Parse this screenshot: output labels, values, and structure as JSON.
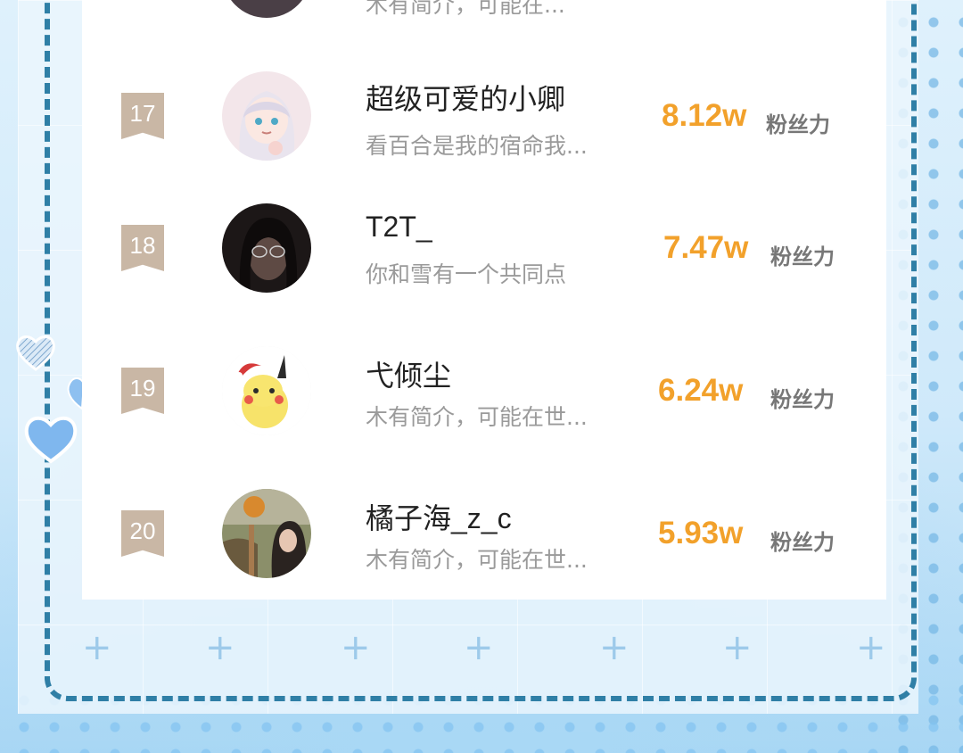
{
  "leaderboard": {
    "partial_top": {
      "bio": "木有简介，可能在..."
    },
    "items": [
      {
        "rank": "17",
        "name": "超级可爱的小卿",
        "bio": "看百合是我的宿命我...",
        "value": "8.12w",
        "unit": "粉丝力",
        "avatar_icon": "anime-girl-avatar"
      },
      {
        "rank": "18",
        "name": "T2T_",
        "bio": "你和雪有一个共同点",
        "value": "7.47w",
        "unit": "粉丝力",
        "avatar_icon": "person-photo-avatar"
      },
      {
        "rank": "19",
        "name": "弋倾尘",
        "bio": "木有简介，可能在世...",
        "value": "6.24w",
        "unit": "粉丝力",
        "avatar_icon": "pikachu-avatar"
      },
      {
        "rank": "20",
        "name": "橘子海_z_c",
        "bio": "木有简介，可能在世...",
        "value": "5.93w",
        "unit": "粉丝力",
        "avatar_icon": "outdoor-photo-avatar"
      }
    ]
  },
  "colors": {
    "accent_value": "#f2a12b",
    "rank_badge": "#c9b7a5",
    "frame": "#2f7fa6"
  }
}
